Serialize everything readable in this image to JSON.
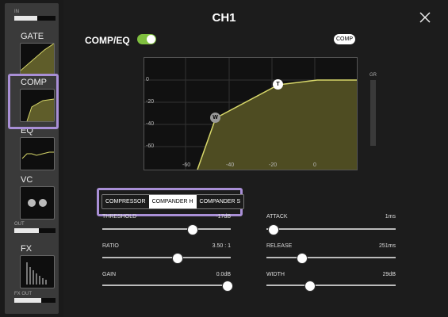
{
  "sidebar": {
    "in_label": "IN",
    "in_level": 0.55,
    "items": [
      {
        "label": "GATE"
      },
      {
        "label": "COMP"
      },
      {
        "label": "EQ"
      },
      {
        "label": "VC"
      },
      {
        "label": "FX"
      }
    ],
    "out_label": "OUT",
    "out_level": 0.6,
    "fxout_label": "FX OUT",
    "fxout_level": 0.65
  },
  "header": {
    "title": "CH1",
    "close_icon": "close-icon"
  },
  "comp_eq": {
    "title": "COMP/EQ",
    "enabled": true,
    "badge": "COMP",
    "gr_label": "GR",
    "accent_color": "#d8d86a",
    "highlight_color": "#a98fd6"
  },
  "graph": {
    "y_ticks": [
      "0",
      "-20",
      "-40",
      "-60"
    ],
    "x_ticks": [
      "-60",
      "-40",
      "-20",
      "0"
    ],
    "handle_t": "T",
    "handle_w": "W"
  },
  "mode_tabs": [
    "COMPRESSOR",
    "COMPANDER H",
    "COMPANDER S"
  ],
  "active_tab": 1,
  "params": {
    "threshold": {
      "label": "THRESHOLD",
      "value": "-17dB",
      "level": 0.7
    },
    "ratio": {
      "label": "RATIO",
      "value": "3.50 : 1",
      "level": 0.58
    },
    "gain": {
      "label": "GAIN",
      "value": "0.0dB",
      "level": 0.97
    },
    "attack": {
      "label": "ATTACK",
      "value": "1ms",
      "level": 0.05
    },
    "release": {
      "label": "RELEASE",
      "value": "251ms",
      "level": 0.27
    },
    "width": {
      "label": "WIDTH",
      "value": "29dB",
      "level": 0.33
    }
  }
}
